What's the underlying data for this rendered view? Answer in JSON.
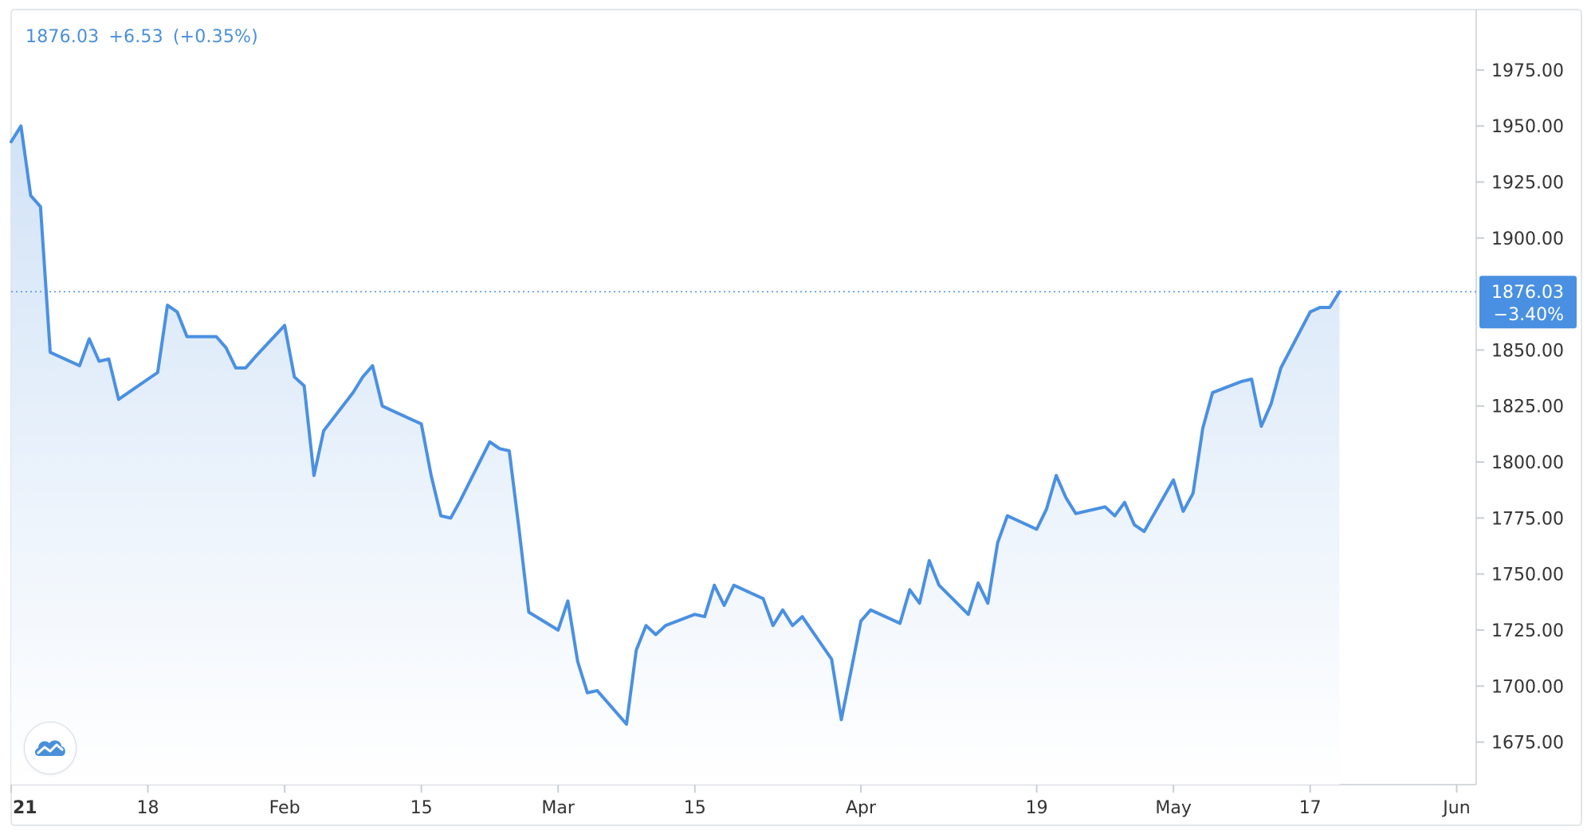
{
  "legend": {
    "price": "1876.03",
    "change": "+6.53",
    "change_pct": "(+0.35%)"
  },
  "last_label": {
    "price": "1876.03",
    "pct": "−3.40%"
  },
  "colors": {
    "line": "#4a90e2",
    "fill_top": "#cfe1f6",
    "label_bg": "#4a90e2",
    "axis_text": "#333333",
    "grid": "#e6e9ee"
  },
  "chart_data": {
    "type": "area",
    "title": "",
    "xlabel": "",
    "ylabel": "",
    "ylim": [
      1656,
      2002
    ],
    "y_ticks": [
      "1975.00",
      "1950.00",
      "1925.00",
      "1900.00",
      "1850.00",
      "1825.00",
      "1800.00",
      "1775.00",
      "1750.00",
      "1725.00",
      "1700.00",
      "1675.00"
    ],
    "x_ticks": [
      {
        "label": "21",
        "date": "2021-01-04",
        "bold": true
      },
      {
        "label": "18",
        "date": "2021-01-18"
      },
      {
        "label": "Feb",
        "date": "2021-02-01"
      },
      {
        "label": "15",
        "date": "2021-02-15"
      },
      {
        "label": "Mar",
        "date": "2021-03-01"
      },
      {
        "label": "15",
        "date": "2021-03-15"
      },
      {
        "label": "Apr",
        "date": "2021-04-01"
      },
      {
        "label": "19",
        "date": "2021-04-19"
      },
      {
        "label": "May",
        "date": "2021-05-03"
      },
      {
        "label": "17",
        "date": "2021-05-17"
      },
      {
        "label": "Jun",
        "date": "2021-06-01"
      }
    ],
    "x_range": [
      "2021-01-04",
      "2021-06-03"
    ],
    "last_value": 1876.03,
    "series": [
      {
        "values": [
          [
            "2021-01-04",
            1943
          ],
          [
            "2021-01-05",
            1950
          ],
          [
            "2021-01-06",
            1919
          ],
          [
            "2021-01-07",
            1914
          ],
          [
            "2021-01-08",
            1849
          ],
          [
            "2021-01-11",
            1843
          ],
          [
            "2021-01-12",
            1855
          ],
          [
            "2021-01-13",
            1845
          ],
          [
            "2021-01-14",
            1846
          ],
          [
            "2021-01-15",
            1828
          ],
          [
            "2021-01-18",
            1837
          ],
          [
            "2021-01-19",
            1840
          ],
          [
            "2021-01-20",
            1870
          ],
          [
            "2021-01-21",
            1867
          ],
          [
            "2021-01-22",
            1856
          ],
          [
            "2021-01-25",
            1856
          ],
          [
            "2021-01-26",
            1851
          ],
          [
            "2021-01-27",
            1842
          ],
          [
            "2021-01-28",
            1842
          ],
          [
            "2021-01-29",
            1847
          ],
          [
            "2021-02-01",
            1861
          ],
          [
            "2021-02-02",
            1838
          ],
          [
            "2021-02-03",
            1834
          ],
          [
            "2021-02-04",
            1794
          ],
          [
            "2021-02-05",
            1814
          ],
          [
            "2021-02-08",
            1831
          ],
          [
            "2021-02-09",
            1838
          ],
          [
            "2021-02-10",
            1843
          ],
          [
            "2021-02-11",
            1825
          ],
          [
            "2021-02-12",
            1823
          ],
          [
            "2021-02-15",
            1817
          ],
          [
            "2021-02-16",
            1794
          ],
          [
            "2021-02-17",
            1776
          ],
          [
            "2021-02-18",
            1775
          ],
          [
            "2021-02-19",
            1783
          ],
          [
            "2021-02-22",
            1809
          ],
          [
            "2021-02-23",
            1806
          ],
          [
            "2021-02-24",
            1805
          ],
          [
            "2021-02-25",
            1770
          ],
          [
            "2021-02-26",
            1733
          ],
          [
            "2021-03-01",
            1725
          ],
          [
            "2021-03-02",
            1738
          ],
          [
            "2021-03-03",
            1711
          ],
          [
            "2021-03-04",
            1697
          ],
          [
            "2021-03-05",
            1698
          ],
          [
            "2021-03-08",
            1683
          ],
          [
            "2021-03-09",
            1716
          ],
          [
            "2021-03-10",
            1727
          ],
          [
            "2021-03-11",
            1723
          ],
          [
            "2021-03-12",
            1727
          ],
          [
            "2021-03-15",
            1732
          ],
          [
            "2021-03-16",
            1731
          ],
          [
            "2021-03-17",
            1745
          ],
          [
            "2021-03-18",
            1736
          ],
          [
            "2021-03-19",
            1745
          ],
          [
            "2021-03-22",
            1739
          ],
          [
            "2021-03-23",
            1727
          ],
          [
            "2021-03-24",
            1734
          ],
          [
            "2021-03-25",
            1727
          ],
          [
            "2021-03-26",
            1731
          ],
          [
            "2021-03-29",
            1712
          ],
          [
            "2021-03-30",
            1685
          ],
          [
            "2021-03-31",
            1707
          ],
          [
            "2021-04-01",
            1729
          ],
          [
            "2021-04-02",
            1734
          ],
          [
            "2021-04-05",
            1728
          ],
          [
            "2021-04-06",
            1743
          ],
          [
            "2021-04-07",
            1737
          ],
          [
            "2021-04-08",
            1756
          ],
          [
            "2021-04-09",
            1745
          ],
          [
            "2021-04-12",
            1732
          ],
          [
            "2021-04-13",
            1746
          ],
          [
            "2021-04-14",
            1737
          ],
          [
            "2021-04-15",
            1764
          ],
          [
            "2021-04-16",
            1776
          ],
          [
            "2021-04-19",
            1770
          ],
          [
            "2021-04-20",
            1779
          ],
          [
            "2021-04-21",
            1794
          ],
          [
            "2021-04-22",
            1784
          ],
          [
            "2021-04-23",
            1777
          ],
          [
            "2021-04-26",
            1780
          ],
          [
            "2021-04-27",
            1776
          ],
          [
            "2021-04-28",
            1782
          ],
          [
            "2021-04-29",
            1772
          ],
          [
            "2021-04-30",
            1769
          ],
          [
            "2021-05-03",
            1792
          ],
          [
            "2021-05-04",
            1778
          ],
          [
            "2021-05-05",
            1786
          ],
          [
            "2021-05-06",
            1815
          ],
          [
            "2021-05-07",
            1831
          ],
          [
            "2021-05-10",
            1836
          ],
          [
            "2021-05-11",
            1837
          ],
          [
            "2021-05-12",
            1816
          ],
          [
            "2021-05-13",
            1826
          ],
          [
            "2021-05-14",
            1842
          ],
          [
            "2021-05-17",
            1867
          ],
          [
            "2021-05-18",
            1869
          ],
          [
            "2021-05-19",
            1869
          ],
          [
            "2021-05-20",
            1876.03
          ]
        ]
      }
    ]
  }
}
